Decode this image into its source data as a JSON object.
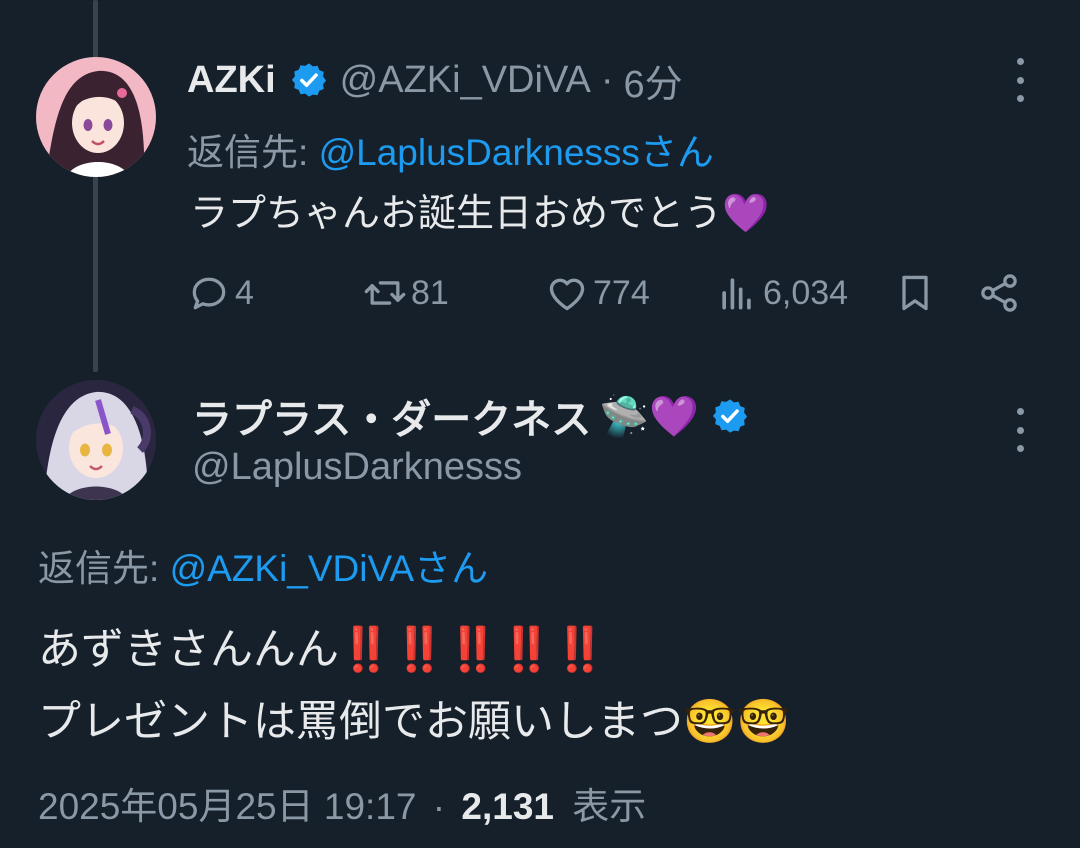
{
  "reply": {
    "display_name": "AZKi",
    "handle": "@AZKi_VDiVA",
    "separator": "·",
    "time": "6分",
    "replying_prefix": "返信先: ",
    "replying_to": "@LaplusDarknesssさん",
    "text": "ラプちゃんお誕生日おめでとう💜",
    "actions": {
      "replies": "4",
      "retweets": "81",
      "likes": "774",
      "views": "6,034"
    }
  },
  "main": {
    "display_name": "ラプラス・ダークネス",
    "name_emojis": "🛸💜",
    "handle": "@LaplusDarknesss",
    "replying_prefix": "返信先: ",
    "replying_to": "@AZKi_VDiVAさん",
    "text_line1": "あずきさんんん‼️‼️‼️‼️‼️",
    "text_line2": "プレゼントは罵倒でお願いしまつ🤓🤓",
    "timestamp": "2025年05月25日 19:17",
    "separator": "·",
    "views_count": "2,131",
    "views_label": "表示"
  },
  "colors": {
    "background": "#15202b",
    "text": "#e7e9ea",
    "secondary": "#8b98a5",
    "link": "#1d9bf0",
    "thread_line": "#38444d"
  },
  "icons": [
    "reply-icon",
    "retweet-icon",
    "like-icon",
    "views-icon",
    "bookmark-icon",
    "share-icon",
    "verified-icon",
    "more-icon"
  ]
}
